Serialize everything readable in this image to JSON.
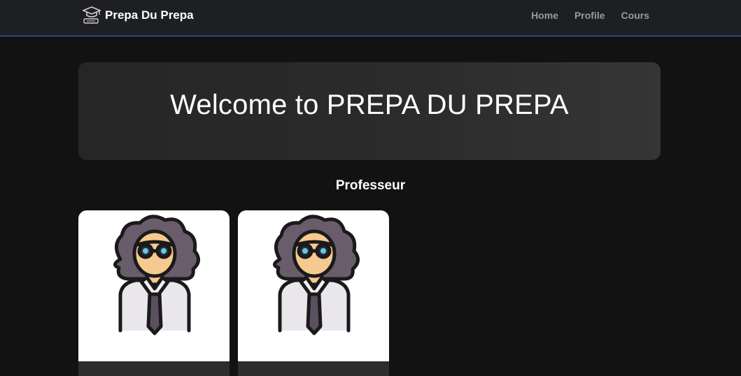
{
  "navbar": {
    "brand_icon": "graduation-cap-icon",
    "brand_name": "Prepa Du Prepa",
    "links": [
      "Home",
      "Profile",
      "Cours"
    ]
  },
  "hero": {
    "title": "Welcome to PREPA DU PREPA"
  },
  "section": {
    "title": "Professeur"
  },
  "cards": [
    {
      "avatar_icon": "professor-avatar-icon"
    },
    {
      "avatar_icon": "professor-avatar-icon"
    }
  ],
  "colors": {
    "navbar_bg": "#1e1f22",
    "navbar_border": "#3d6fd1",
    "page_bg": "#121212",
    "hero_bg": "#2b2b2b",
    "nav_link": "#9a9a9a"
  }
}
